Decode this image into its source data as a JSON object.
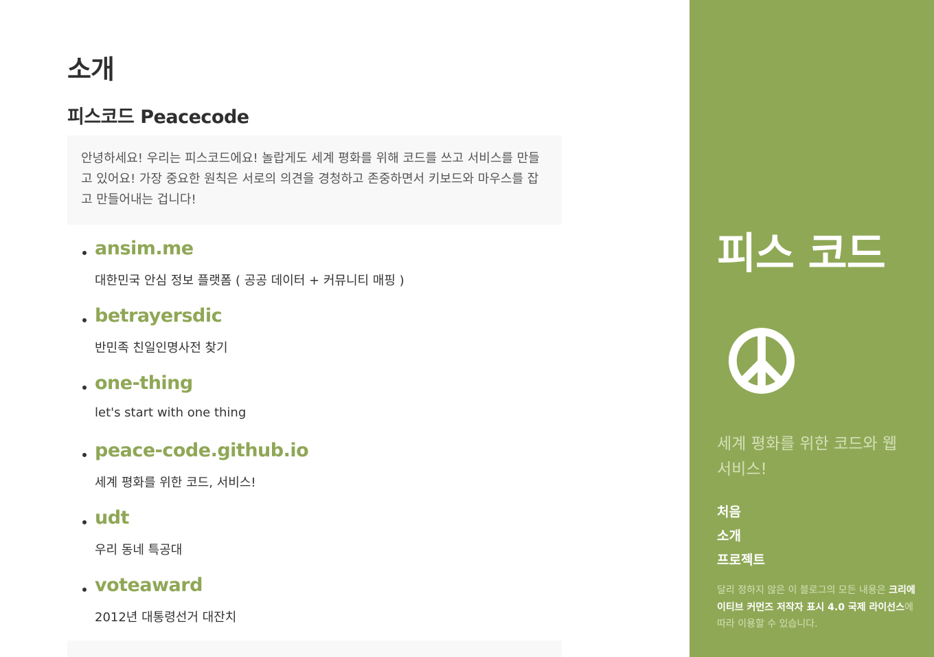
{
  "main": {
    "title": "소개",
    "subtitle": "피스코드 Peacecode",
    "intro": "안녕하세요! 우리는 피스코드에요! 놀랍게도 세계 평화를 위해 코드를 쓰고 서비스를 만들고 있어요! 가장 중요한 원칙은 서로의 의견을 경청하고 존중하면서 키보드와 마우스를 잡고 만들어내는 겁니다!",
    "projects": [
      {
        "name": "ansim.me",
        "desc": "대한민국 안심 정보 플랫폼 ( 공공 데이터 + 커뮤니티 매핑 )"
      },
      {
        "name": "betrayersdic",
        "desc": "반민족 친일인명사전 찾기"
      },
      {
        "name": "one-thing",
        "desc": "let's start with one thing"
      },
      {
        "name": "peace-code.github.io",
        "desc": "세계 평화를 위한 코드, 서비스!"
      },
      {
        "name": "udt",
        "desc": "우리 동네 특공대"
      },
      {
        "name": "voteaward",
        "desc": "2012년 대통령선거 대잔치"
      }
    ]
  },
  "sidebar": {
    "site_title": "피스 코드",
    "logo_icon": "peace-sign-icon",
    "tagline": "세계 평화를 위한 코드와 웹 서비스!",
    "nav": [
      {
        "label": "처음"
      },
      {
        "label": "소개"
      },
      {
        "label": "프로젝트"
      }
    ],
    "license": {
      "prefix": "달리 정하지 않은 이 블로그의 모든 내용은 ",
      "link": "크리에이티브 커먼즈 저작자 표시 4.0 국제 라이선스",
      "suffix": "에 따라 이용할 수 있습니다."
    }
  },
  "colors": {
    "accent": "#8fa756",
    "sidebar_bg": "#8fa856",
    "intro_bg": "#f8f8f8",
    "text": "#333333"
  }
}
